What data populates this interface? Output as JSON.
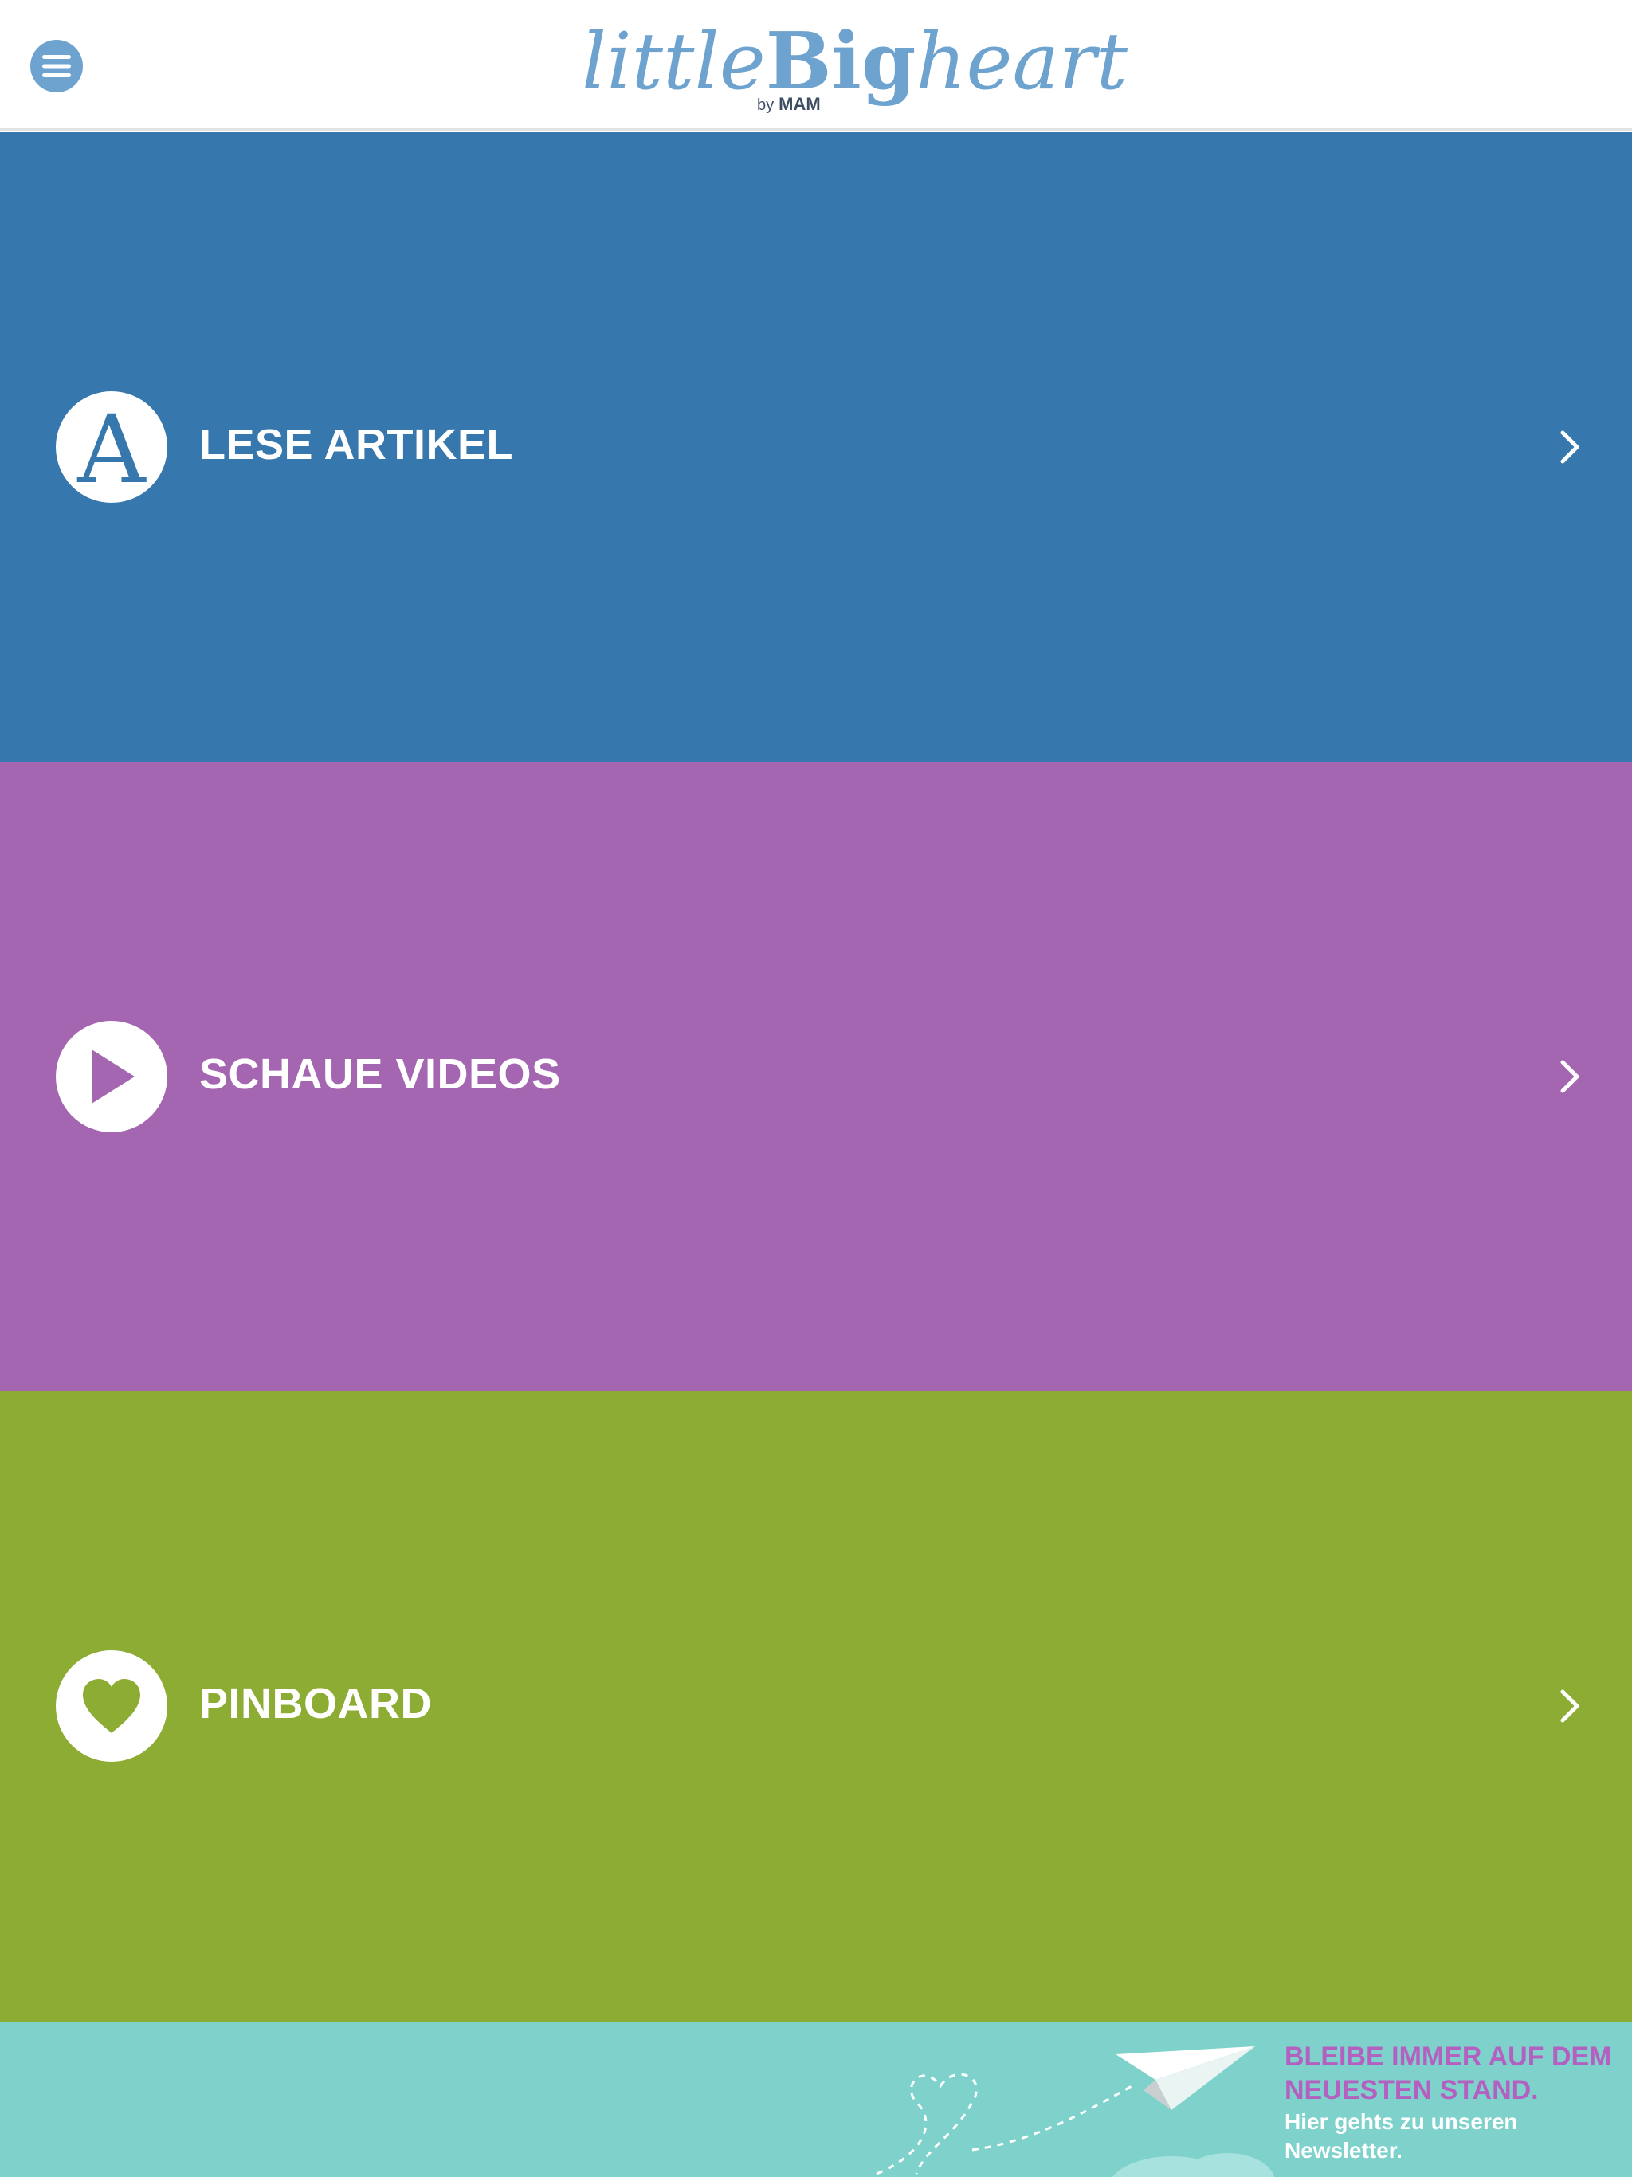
{
  "header": {
    "logo": {
      "part_little": "little",
      "part_big": "Big",
      "part_heart": "heart",
      "by": "by",
      "brand": "MAM"
    },
    "menu_icon": "hamburger-menu-icon"
  },
  "sections": [
    {
      "label": "LESE ARTIKEL",
      "icon": "letter-a-icon",
      "icon_glyph": "A",
      "color": "#3677ad"
    },
    {
      "label": "SCHAUE VIDEOS",
      "icon": "play-icon",
      "color": "#a566b1"
    },
    {
      "label": "PINBOARD",
      "icon": "heart-icon",
      "color": "#8dac33"
    }
  ],
  "newsletter": {
    "headline_line1": "BLEIBE IMMER AUF DEM",
    "headline_line2": "NEUESTEN STAND.",
    "sub_line1": "Hier gehts zu unseren",
    "sub_line2": "Newsletter.",
    "background": "#7fd2cc",
    "accent": "#b460c0"
  },
  "colors": {
    "logo_blue": "#6ea3cf"
  }
}
